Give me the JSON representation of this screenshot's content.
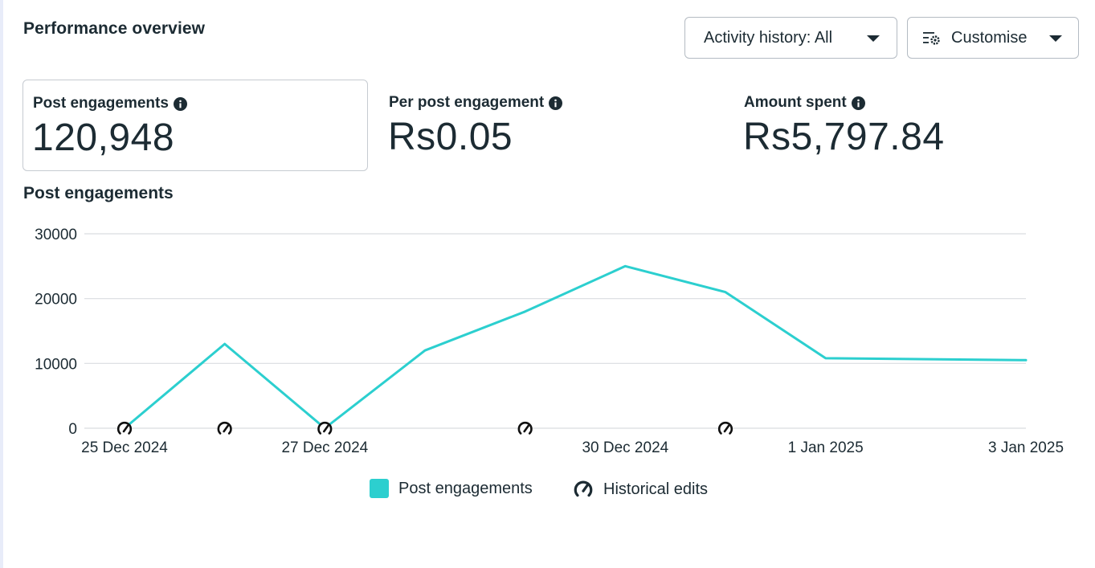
{
  "header": {
    "title": "Performance overview",
    "activity_history_label": "Activity history: All",
    "customise_label": "Customise"
  },
  "metrics": [
    {
      "label": "Post engagements",
      "value": "120,948",
      "selected": true
    },
    {
      "label": "Per post engagement",
      "value": "Rs0.05",
      "selected": false
    },
    {
      "label": "Amount spent",
      "value": "Rs5,797.84",
      "selected": false
    }
  ],
  "icons": {
    "info": "info-icon",
    "dropdown": "caret-down-icon",
    "customise": "filter-settings-icon",
    "historical_edit": "speedometer-edit-icon"
  },
  "colors": {
    "series": "#2ccfcf",
    "text": "#1c2b33",
    "grid": "#dadde1"
  },
  "chart_data": {
    "type": "line",
    "title": "Post engagements",
    "ylim": [
      0,
      30000
    ],
    "y_ticks": [
      0,
      10000,
      20000,
      30000
    ],
    "x": [
      "25 Dec 2024",
      "26 Dec 2024",
      "27 Dec 2024",
      "28 Dec 2024",
      "29 Dec 2024",
      "30 Dec 2024",
      "31 Dec 2024",
      "1 Jan 2025",
      "3 Jan 2025"
    ],
    "x_tick_labels": [
      "25 Dec 2024",
      "27 Dec 2024",
      "30 Dec 2024",
      "1 Jan 2025",
      "3 Jan 2025"
    ],
    "series": [
      {
        "name": "Post engagements",
        "values": [
          0,
          13000,
          0,
          12000,
          18000,
          25000,
          21000,
          10800,
          10500
        ]
      }
    ],
    "historical_edits": [
      "25 Dec 2024",
      "26 Dec 2024",
      "27 Dec 2024",
      "29 Dec 2024",
      "31 Dec 2024"
    ],
    "legend": [
      "Post engagements",
      "Historical edits"
    ],
    "legend_position": "bottom-center",
    "grid": true
  }
}
